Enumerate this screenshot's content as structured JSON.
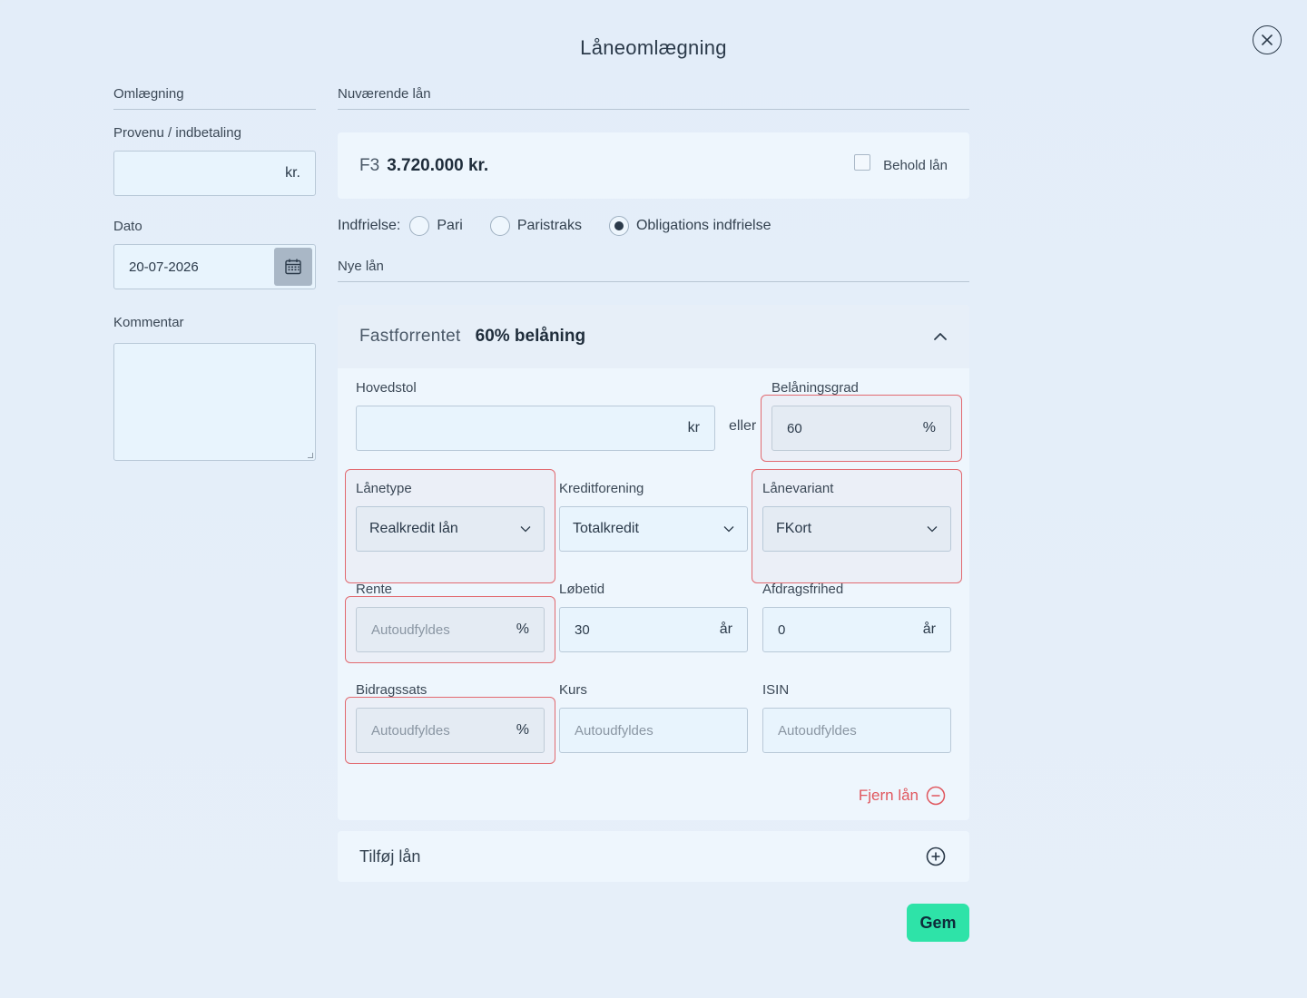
{
  "title": "Låneomlægning",
  "left": {
    "section_label": "Omlægning",
    "provenu_label": "Provenu / indbetaling",
    "provenu_value": "",
    "provenu_unit": "kr.",
    "dato_label": "Dato",
    "dato_value": "20-07-2026",
    "kommentar_label": "Kommentar",
    "kommentar_value": ""
  },
  "current": {
    "section_label": "Nuværende lån",
    "loan_code": "F3",
    "loan_amount": "3.720.000 kr.",
    "keep_label": "Behold lån",
    "keep_checked": false,
    "indfrielse_label": "Indfrielse:",
    "options": [
      {
        "label": "Pari",
        "selected": false
      },
      {
        "label": "Paristraks",
        "selected": false
      },
      {
        "label": "Obligations indfrielse",
        "selected": true
      }
    ]
  },
  "new_loans": {
    "section_label": "Nye lån",
    "loan": {
      "type": "Fastforrentet",
      "belaning_summary": "60% belåning",
      "hovedstol_label": "Hovedstol",
      "hovedstol_value": "",
      "hovedstol_unit": "kr",
      "eller_label": "eller",
      "belaningsgrad_label": "Belåningsgrad",
      "belaningsgrad_value": "60",
      "belaningsgrad_unit": "%",
      "lanetype_label": "Lånetype",
      "lanetype_value": "Realkredit lån",
      "kreditforening_label": "Kreditforening",
      "kreditforening_value": "Totalkredit",
      "lanevariant_label": "Lånevariant",
      "lanevariant_value": "FKort",
      "rente_label": "Rente",
      "rente_placeholder": "Autoudfyldes",
      "rente_unit": "%",
      "lobetid_label": "Løbetid",
      "lobetid_value": "30",
      "lobetid_unit": "år",
      "afdragsfrihed_label": "Afdragsfrihed",
      "afdragsfrihed_value": "0",
      "afdragsfrihed_unit": "år",
      "bidragssats_label": "Bidragssats",
      "bidragssats_placeholder": "Autoudfyldes",
      "bidragssats_unit": "%",
      "kurs_label": "Kurs",
      "kurs_placeholder": "Autoudfyldes",
      "isin_label": "ISIN",
      "isin_placeholder": "Autoudfyldes",
      "remove_label": "Fjern lån"
    },
    "add_label": "Tilføj lån"
  },
  "save_label": "Gem",
  "colors": {
    "accent": "#2ee3a8",
    "danger": "#e0575e",
    "highlight_border": "#e26a70"
  }
}
